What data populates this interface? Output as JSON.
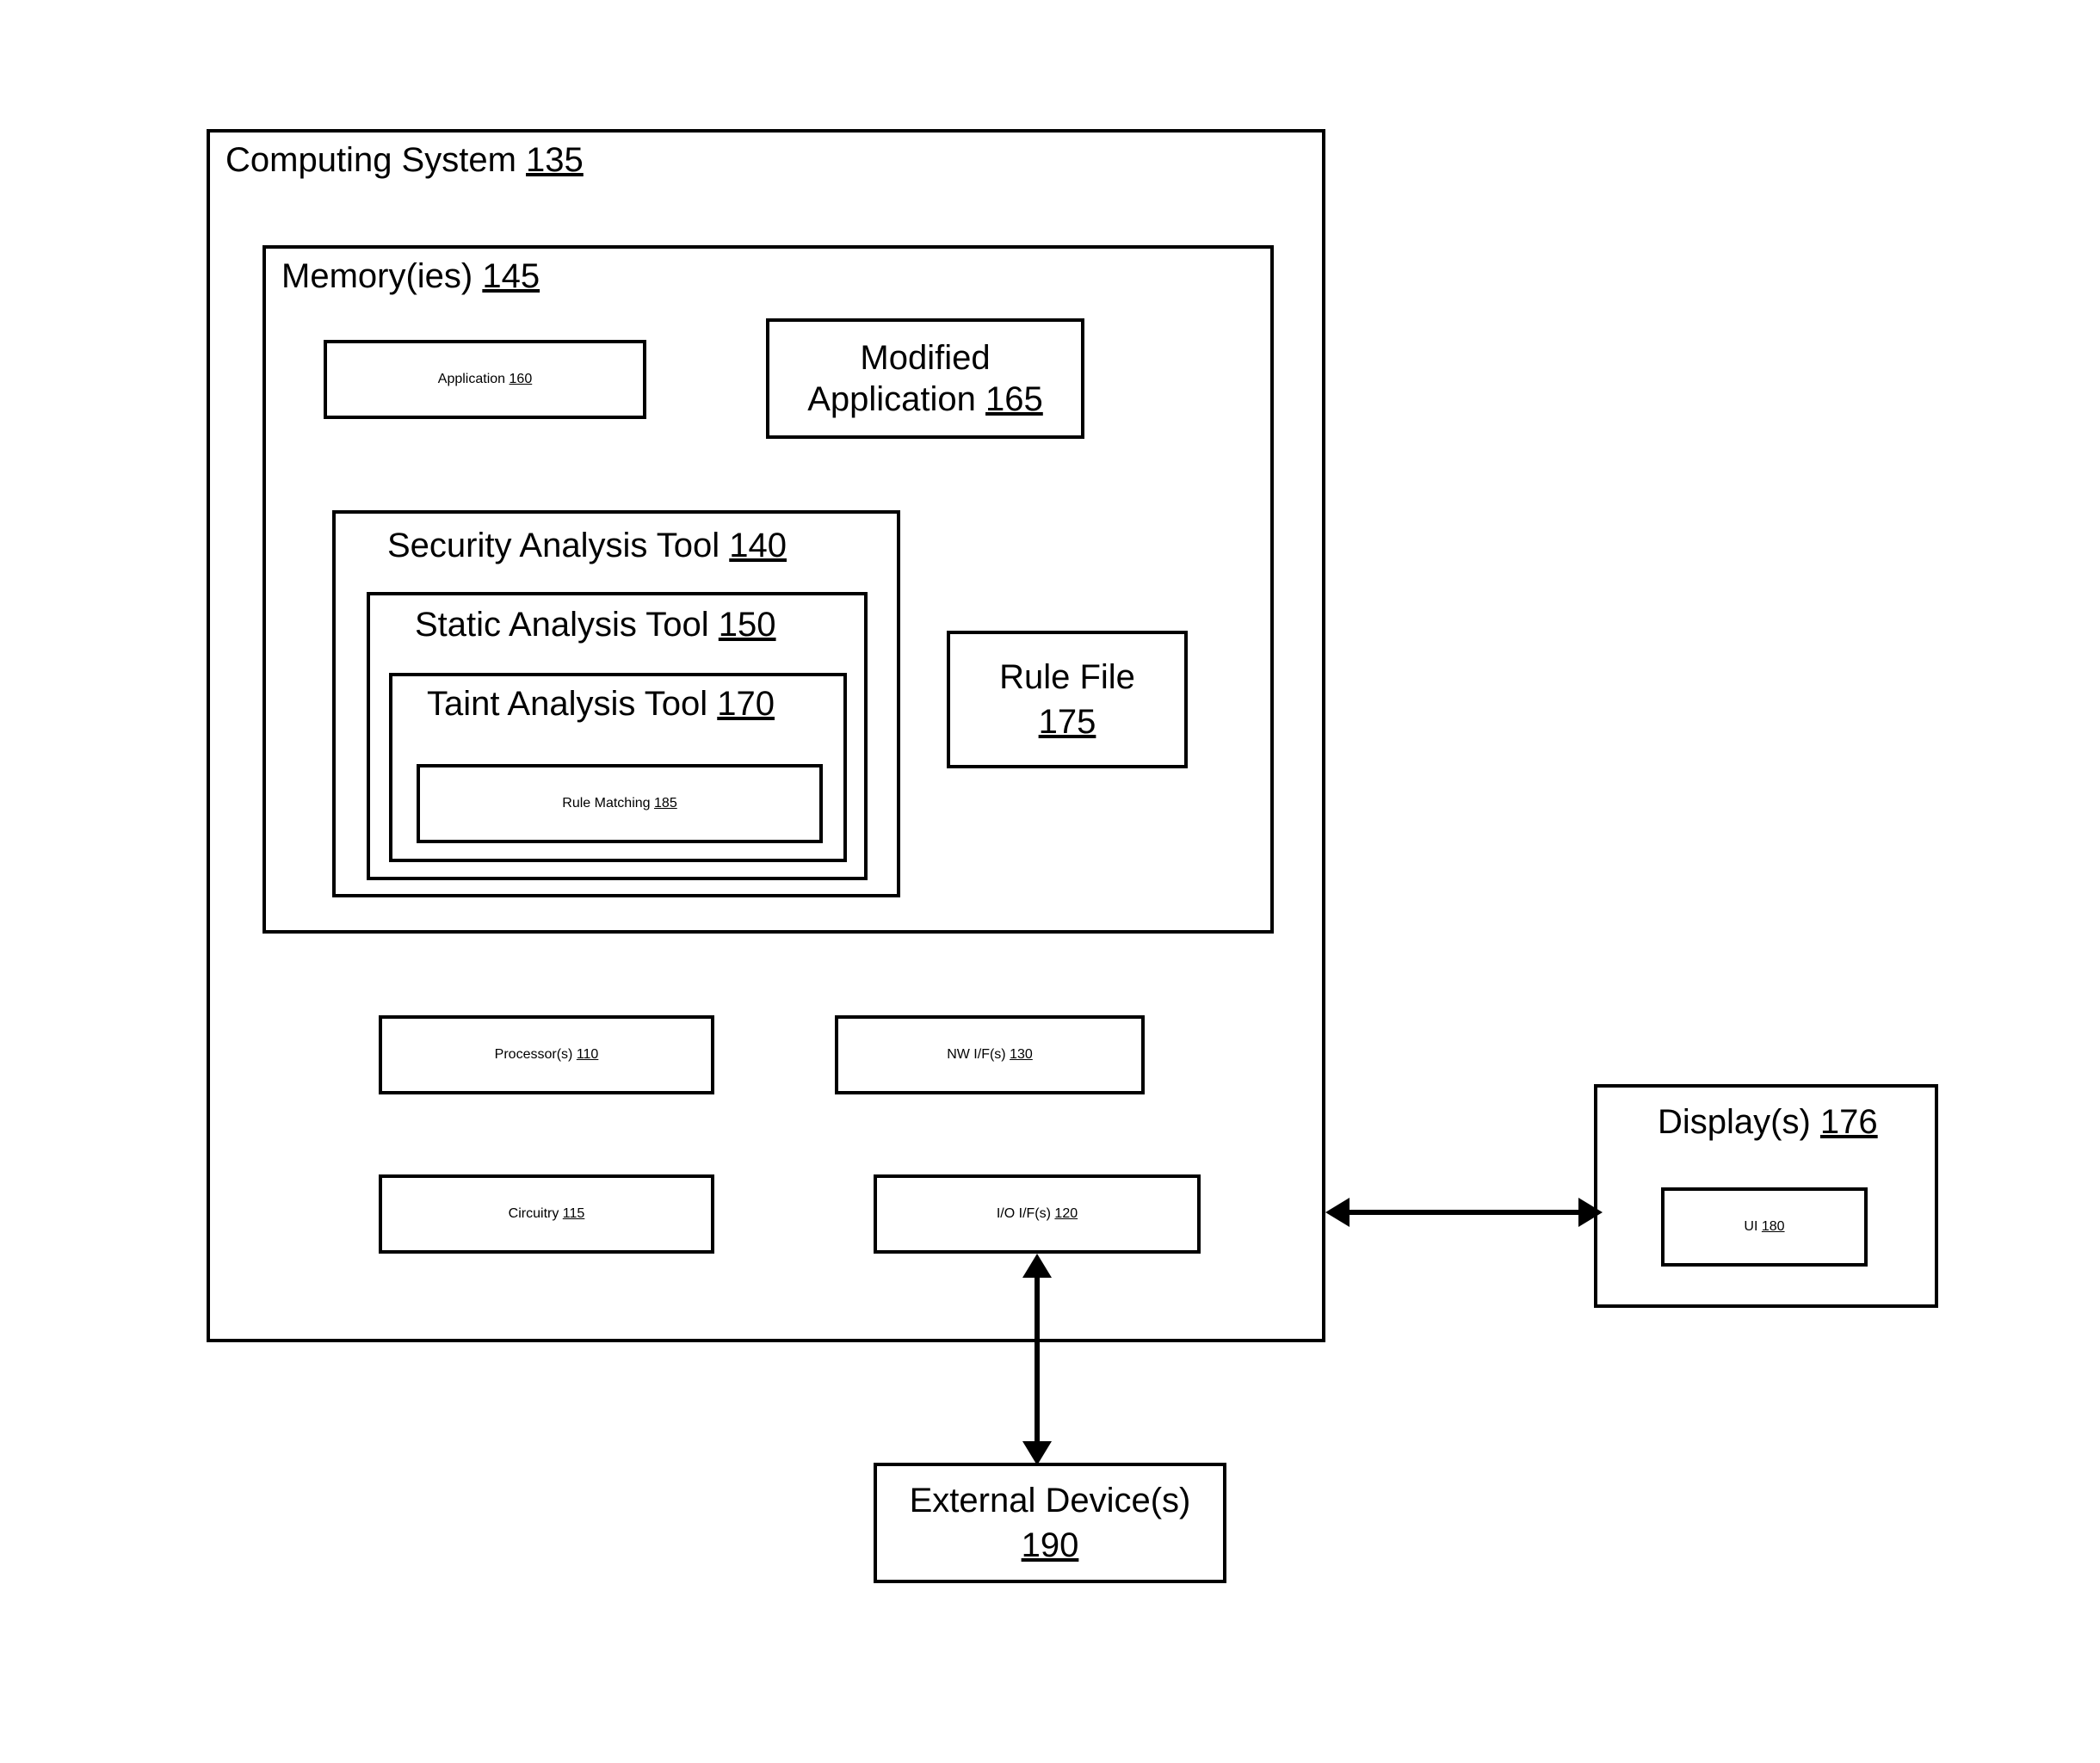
{
  "computing_system": {
    "label": "Computing System",
    "num": "135"
  },
  "memory": {
    "label": "Memory(ies)",
    "num": "145"
  },
  "application": {
    "label": "Application",
    "num": "160"
  },
  "modified_application": {
    "label_line1": "Modified",
    "label_line2": "Application",
    "num": "165"
  },
  "security_tool": {
    "label": "Security Analysis Tool",
    "num": "140"
  },
  "static_tool": {
    "label": "Static Analysis Tool",
    "num": "150"
  },
  "taint_tool": {
    "label": "Taint Analysis Tool",
    "num": "170"
  },
  "rule_matching": {
    "label": "Rule Matching",
    "num": "185"
  },
  "rule_file": {
    "label_line1": "Rule File",
    "num": "175"
  },
  "processors": {
    "label": "Processor(s)",
    "num": "110"
  },
  "nw_if": {
    "label": "NW I/F(s)",
    "num": "130"
  },
  "circuitry": {
    "label": "Circuitry",
    "num": "115"
  },
  "io_if": {
    "label": "I/O I/F(s)",
    "num": "120"
  },
  "displays": {
    "label": "Display(s)",
    "num": "176"
  },
  "ui": {
    "label": "UI",
    "num": "180"
  },
  "external_devices": {
    "label_line1": "External Device(s)",
    "num": "190"
  }
}
